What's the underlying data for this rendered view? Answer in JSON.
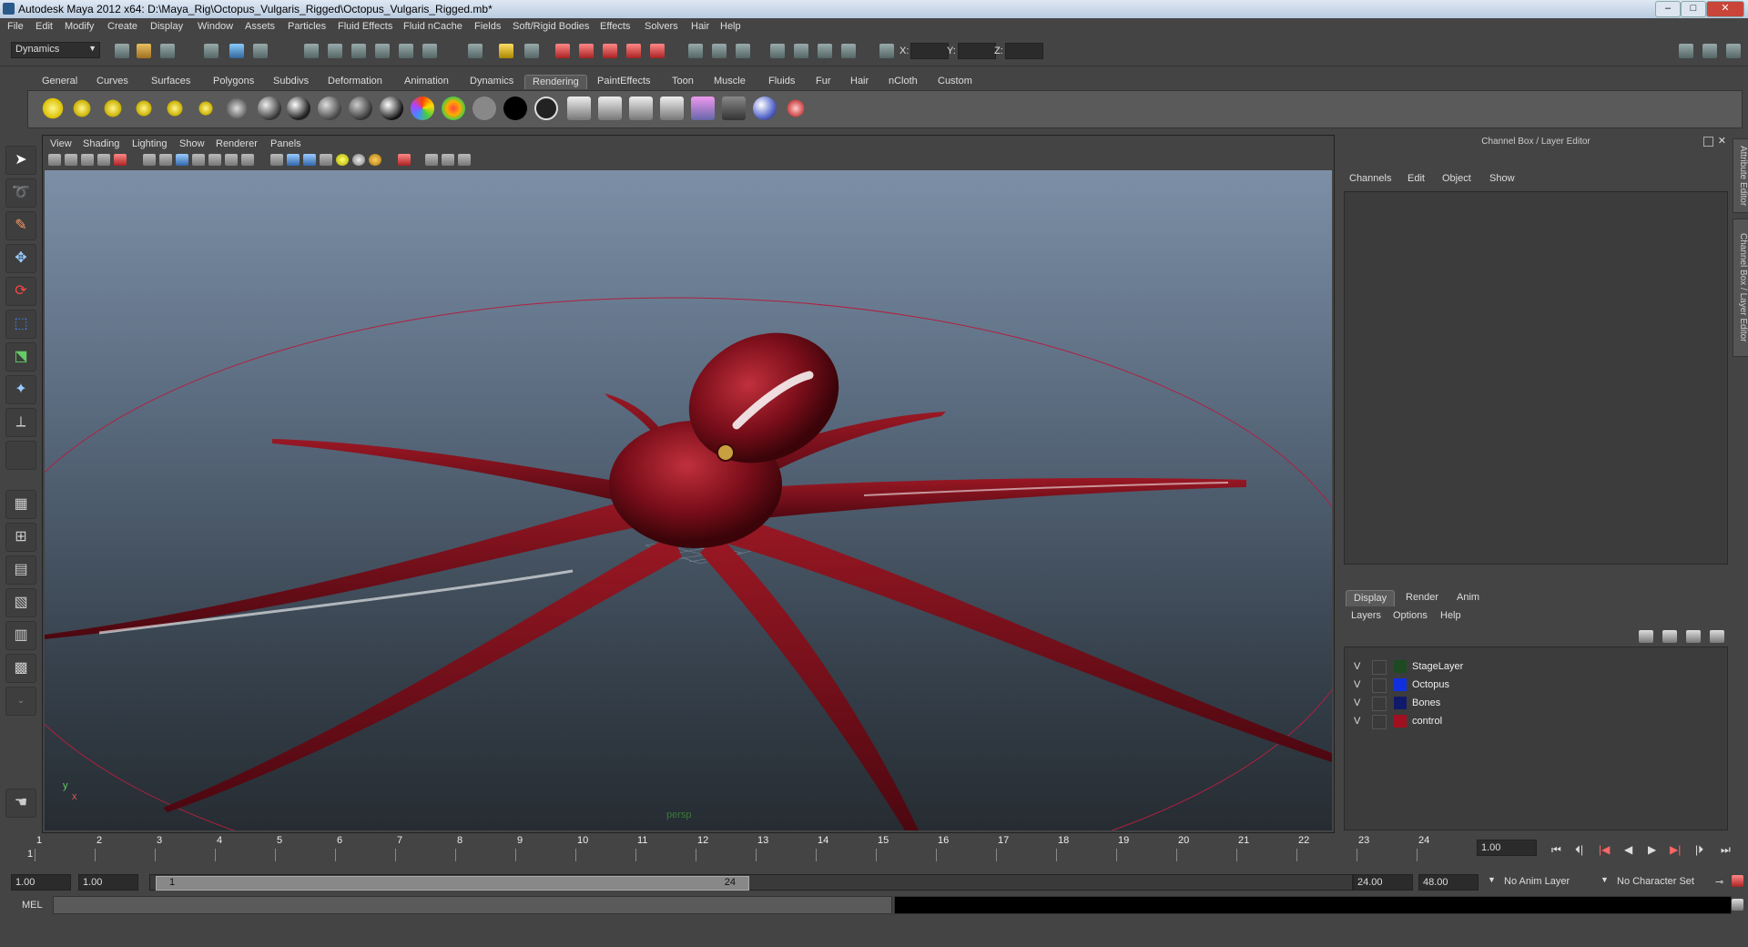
{
  "window": {
    "title": "Autodesk Maya 2012 x64: D:\\Maya_Rig\\Octopus_Vulgaris_Rigged\\Octopus_Vulgaris_Rigged.mb*",
    "controls": [
      "–",
      "□",
      "✕"
    ]
  },
  "menubar": [
    "File",
    "Edit",
    "Modify",
    "Create",
    "Display",
    "Window",
    "Assets",
    "Particles",
    "Fluid Effects",
    "Fluid nCache",
    "Fields",
    "Soft/Rigid Bodies",
    "Effects",
    "Solvers",
    "Hair",
    "Help"
  ],
  "statusline": {
    "menu_set": "Dynamics",
    "x_label": "X:",
    "y_label": "Y:",
    "z_label": "Z:"
  },
  "shelf": {
    "tabs": [
      "General",
      "Curves",
      "Surfaces",
      "Polygons",
      "Subdivs",
      "Deformation",
      "Animation",
      "Dynamics",
      "Rendering",
      "PaintEffects",
      "Toon",
      "Muscle",
      "Fluids",
      "Fur",
      "Hair",
      "nCloth",
      "Custom"
    ],
    "active_tab": "Rendering"
  },
  "viewport": {
    "menus": [
      "View",
      "Shading",
      "Lighting",
      "Show",
      "Renderer",
      "Panels"
    ],
    "camera_label": "persp",
    "axis_x": "x",
    "axis_y": "y",
    "model_color": "#7a0e1a"
  },
  "channel_box": {
    "title": "Channel Box / Layer Editor",
    "menus": [
      "Channels",
      "Edit",
      "Object",
      "Show"
    ]
  },
  "layer_editor": {
    "tabs": [
      "Display",
      "Render",
      "Anim"
    ],
    "active_tab": "Display",
    "menus": [
      "Layers",
      "Options",
      "Help"
    ],
    "layers": [
      {
        "visible": "V",
        "name": "StageLayer",
        "color": "#1d4a22"
      },
      {
        "visible": "V",
        "name": "Octopus",
        "color": "#1030e0"
      },
      {
        "visible": "V",
        "name": "Bones",
        "color": "#101a6a"
      },
      {
        "visible": "V",
        "name": "control",
        "color": "#a01020"
      }
    ]
  },
  "side_tabs": [
    "Attribute Editor",
    "Channel Box / Layer Editor"
  ],
  "timeline": {
    "frames": [
      "1",
      "2",
      "3",
      "4",
      "5",
      "6",
      "7",
      "8",
      "9",
      "10",
      "11",
      "12",
      "13",
      "14",
      "15",
      "16",
      "17",
      "18",
      "19",
      "20",
      "21",
      "22",
      "23",
      "24"
    ],
    "current_frame_marker": "1",
    "current_time": "1.00"
  },
  "range": {
    "start_time": "1.00",
    "playback_start": "1.00",
    "slider_start": "1",
    "slider_end": "24",
    "playback_end": "24.00",
    "end_time": "48.00",
    "anim_layer": "No Anim Layer",
    "character_set": "No Character Set"
  },
  "command_line": {
    "label": "MEL"
  }
}
